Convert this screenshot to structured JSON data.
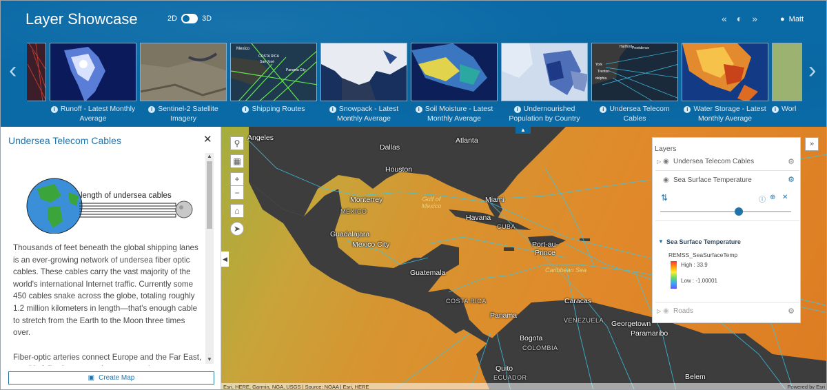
{
  "header": {
    "title": "Layer Showcase",
    "toggle_2d": "2D",
    "toggle_3d": "3D",
    "user": "Matt"
  },
  "carousel": {
    "items": [
      {
        "label": "Runoff - Latest Monthly Average",
        "theme": "dark-blue-white"
      },
      {
        "label": "Sentinel-2 Satellite Imagery",
        "theme": "satellite"
      },
      {
        "label": "Shipping Routes",
        "theme": "green-lines",
        "overlay_text": [
          "Mexico",
          "COSTA RICA",
          "San José",
          "Panama City"
        ]
      },
      {
        "label": "Snowpack - Latest Monthly Average",
        "theme": "snow"
      },
      {
        "label": "Soil Moisture - Latest Monthly Average",
        "theme": "moisture"
      },
      {
        "label": "Undernourished Population by Country",
        "theme": "population"
      },
      {
        "label": "Undersea Telecom Cables",
        "theme": "cables",
        "overlay_text": [
          "Hartford",
          "Providence",
          "York",
          "Trenton",
          "delphia"
        ]
      },
      {
        "label": "Water Storage - Latest Monthly Average",
        "theme": "storage"
      },
      {
        "label": "Worl",
        "theme": "green"
      }
    ]
  },
  "side_panel": {
    "title": "Undersea Telecom Cables",
    "diagram_label": "length of undersea cables",
    "paragraphs": [
      "Thousands of feet beneath the global shipping lanes is an ever-growing network of undersea fiber optic cables. These cables carry the vast majority of the world's international Internet traffic. Currently some 450 cables snake across the globe, totaling roughly 1.2 million kilometers in length—that's enough cable to stretch from the Earth to the Moon three times over.",
      "Fiber-optic arteries connect Europe and the Far East, roughly following routes that ocean-going"
    ],
    "create_button": "Create Map"
  },
  "map": {
    "places": [
      {
        "text": "Angeles",
        "kind": "city"
      },
      {
        "text": "Dallas",
        "kind": "city"
      },
      {
        "text": "Atlanta",
        "kind": "city"
      },
      {
        "text": "Houston",
        "kind": "city"
      },
      {
        "text": "Monterrey",
        "kind": "city"
      },
      {
        "text": "MÉXICO",
        "kind": "country"
      },
      {
        "text": "Gulf of Mexico",
        "kind": "sea"
      },
      {
        "text": "Miami",
        "kind": "city"
      },
      {
        "text": "Havana",
        "kind": "city"
      },
      {
        "text": "CUBA",
        "kind": "country"
      },
      {
        "text": "Guadalajara",
        "kind": "city"
      },
      {
        "text": "Mexico City",
        "kind": "city"
      },
      {
        "text": "Port-au-Prince",
        "kind": "city"
      },
      {
        "text": "Caribbean Sea",
        "kind": "sea"
      },
      {
        "text": "Guatemala",
        "kind": "city"
      },
      {
        "text": "COSTA RICA",
        "kind": "country"
      },
      {
        "text": "Panama",
        "kind": "city"
      },
      {
        "text": "Caracas",
        "kind": "city"
      },
      {
        "text": "VENEZUELA",
        "kind": "country"
      },
      {
        "text": "Georgetown",
        "kind": "city"
      },
      {
        "text": "Paramaribo",
        "kind": "city"
      },
      {
        "text": "Bogota",
        "kind": "city"
      },
      {
        "text": "COLOMBIA",
        "kind": "country"
      },
      {
        "text": "Quito",
        "kind": "city"
      },
      {
        "text": "ECUADOR",
        "kind": "country"
      },
      {
        "text": "Belem",
        "kind": "city"
      }
    ],
    "attribution": "Esri, HERE, Garmin, NGA, USGS | Source: NOAA | Esri, HERE",
    "powered_by": "Powered by Esri"
  },
  "layers": {
    "title": "Layers",
    "items": [
      {
        "name": "Undersea Telecom Cables",
        "expanded": false,
        "visible": true
      },
      {
        "name": "Sea Surface Temperature",
        "expanded": true,
        "visible": true
      },
      {
        "name": "Roads",
        "expanded": false,
        "visible": false
      }
    ],
    "opacity": 0.6,
    "legend": {
      "title": "Sea Surface Temperature",
      "field": "REMSS_SeaSurfaceTemp",
      "high": "High : 33.9",
      "low": "Low : -1.00001"
    }
  },
  "colors": {
    "header_bg": "#0a6aa6",
    "accent": "#2273a8",
    "cable_lines": "#38c6e8",
    "land": "#3d3d3d"
  }
}
